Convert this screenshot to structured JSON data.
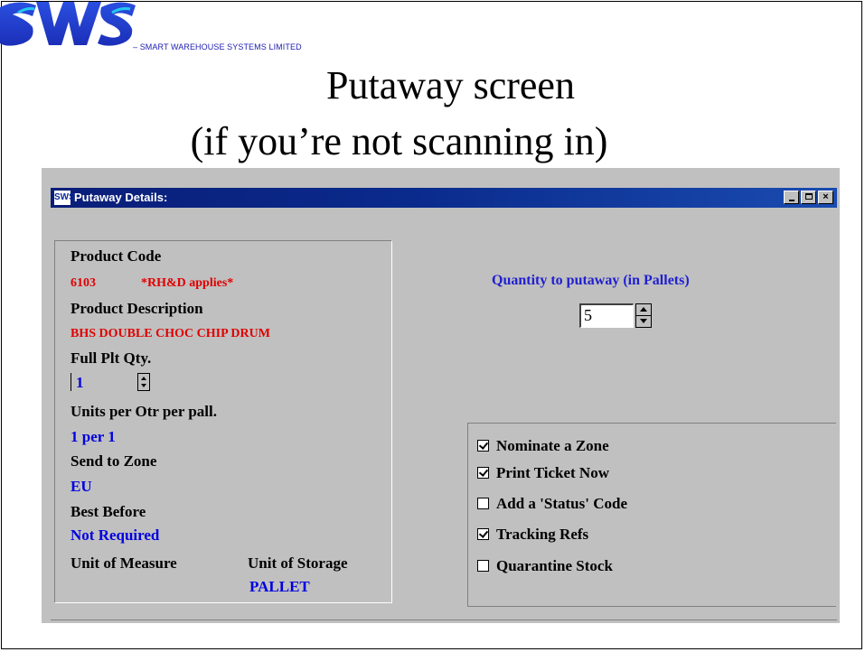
{
  "slide": {
    "logo_text": "SWS",
    "logo_subtitle": "– SMART WAREHOUSE SYSTEMS LIMITED",
    "title_line1": "Putaway screen",
    "title_line2": "(if you’re not scanning in)",
    "colors": {
      "logo_blue": "#1f3fd6",
      "logo_cyan": "#22c4e8"
    }
  },
  "window": {
    "app_icon": "SWS",
    "title": "Putaway Details:",
    "buttons": {
      "minimize": "minimize-icon",
      "maximize": "maximize-icon",
      "close": "×"
    },
    "titlebar_color": "#0a1e78",
    "face_color": "#c0c0c0"
  },
  "details": {
    "product_code_label": "Product Code",
    "product_code": "6103",
    "rhd_note": "*RH&D applies*",
    "product_description_label": "Product Description",
    "product_description": "BHS DOUBLE CHOC CHIP DRUM",
    "full_plt_qty_label": "Full Plt Qty.",
    "full_plt_qty": "1",
    "units_per_label": "Units per Otr per pall.",
    "units_per": "1 per 1",
    "send_to_zone_label": "Send to Zone",
    "send_to_zone": "EU",
    "best_before_label": "Best Before",
    "best_before": "Not Required",
    "unit_of_measure_label": "Unit of Measure",
    "unit_of_storage_label": "Unit of Storage",
    "unit_of_storage": "PALLET",
    "text_colors": {
      "red": "#e00000",
      "blue": "#0000e0"
    }
  },
  "quantity": {
    "label": "Quantity to putaway (in Pallets)",
    "value": "5"
  },
  "options": [
    {
      "label": "Nominate a Zone",
      "checked": true
    },
    {
      "label": "Print Ticket Now",
      "checked": true
    },
    {
      "label": "Add a 'Status' Code",
      "checked": false
    },
    {
      "label": "Tracking Refs",
      "checked": true
    },
    {
      "label": "Quarantine Stock",
      "checked": false
    }
  ]
}
